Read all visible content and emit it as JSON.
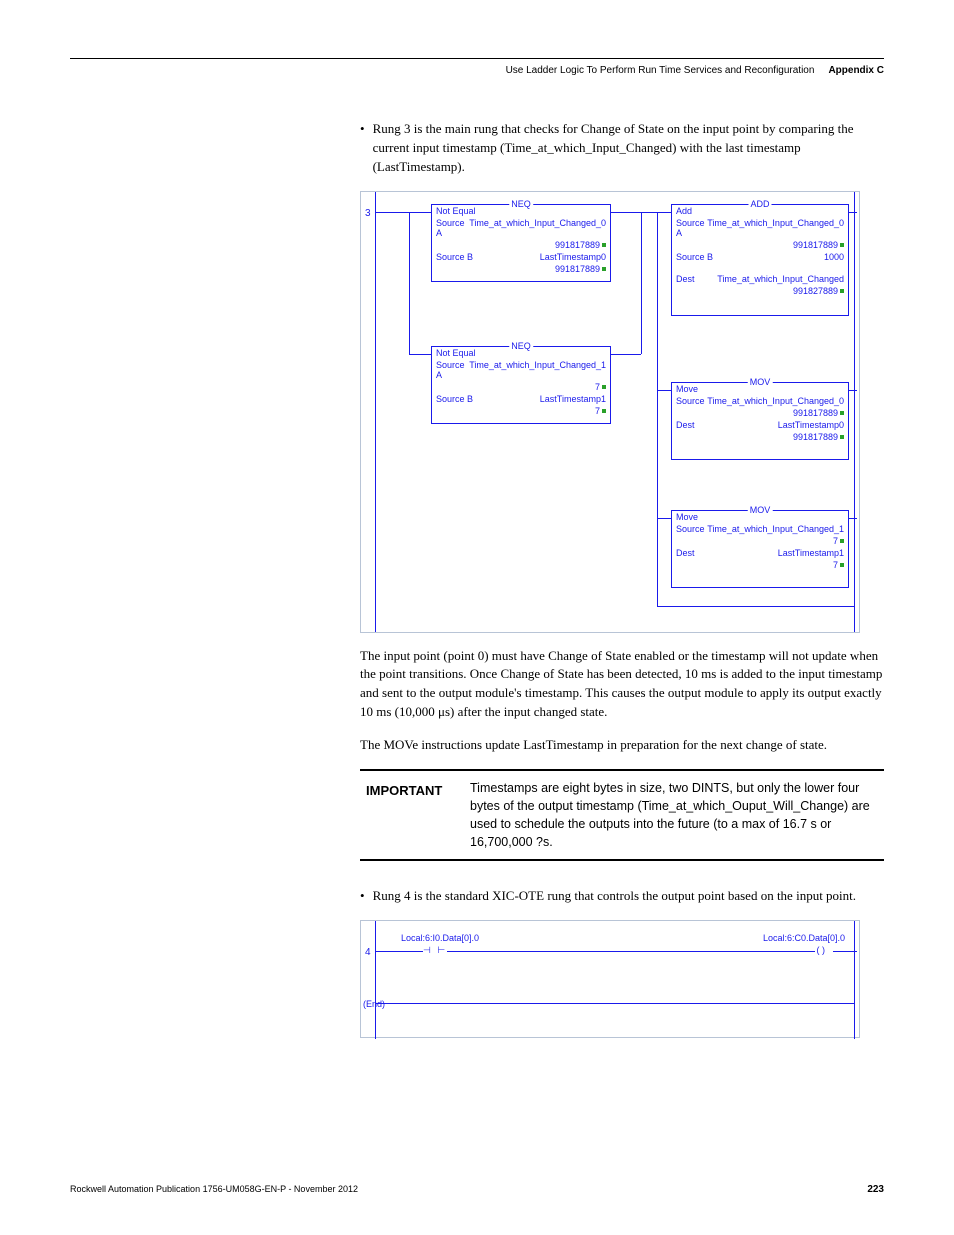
{
  "header": {
    "title": "Use Ladder Logic To Perform Run Time Services and Reconfiguration",
    "appendix": "Appendix C"
  },
  "bullet1": "Rung 3 is the main rung that checks for Change of State on the input point by comparing the current input timestamp (Time_at_which_Input_Changed) with the last timestamp (LastTimestamp).",
  "fig1": {
    "rung": "3",
    "neq1": {
      "title": "NEQ",
      "name": "Not Equal",
      "srcA_l": "Source A",
      "srcA_r": "Time_at_which_Input_Changed_0",
      "srcA_v": "991817889",
      "srcB_l": "Source B",
      "srcB_r": "LastTimestamp0",
      "srcB_v": "991817889"
    },
    "neq2": {
      "title": "NEQ",
      "name": "Not Equal",
      "srcA_l": "Source A",
      "srcA_r": "Time_at_which_Input_Changed_1",
      "srcA_v": "7",
      "srcB_l": "Source B",
      "srcB_r": "LastTimestamp1",
      "srcB_v": "7"
    },
    "add": {
      "title": "ADD",
      "name": "Add",
      "srcA_l": "Source A",
      "srcA_r": "Time_at_which_Input_Changed_0",
      "srcA_v": "991817889",
      "srcB_l": "Source B",
      "srcB_r": "1000",
      "srcB_v": "",
      "dest_l": "Dest",
      "dest_r": "Time_at_which_Input_Changed",
      "dest_v": "991827889"
    },
    "mov1": {
      "title": "MOV",
      "name": "Move",
      "src_l": "Source",
      "src_r": "Time_at_which_Input_Changed_0",
      "src_v": "991817889",
      "dest_l": "Dest",
      "dest_r": "LastTimestamp0",
      "dest_v": "991817889"
    },
    "mov2": {
      "title": "MOV",
      "name": "Move",
      "src_l": "Source",
      "src_r": "Time_at_which_Input_Changed_1",
      "src_v": "7",
      "dest_l": "Dest",
      "dest_r": "LastTimestamp1",
      "dest_v": "7"
    }
  },
  "para1": "The input point (point 0) must have Change of State enabled or the timestamp will not update when the point transitions. Once Change of State has been detected, 10 ms is added to the input timestamp and sent to the output module's timestamp. This causes the output module to apply its output exactly 10 ms (10,000 μs) after the input changed state.",
  "para2": "The MOVe instructions update LastTimestamp in preparation for the next change of state.",
  "callout": {
    "label": "IMPORTANT",
    "text": "Timestamps are eight bytes in size, two DINTS, but only the lower four bytes of the output timestamp (Time_at_which_Ouput_Will_Change) are used to schedule the outputs into the future (to a max of 16.7 s or 16,700,000 ?s."
  },
  "bullet2": "Rung 4 is the standard XIC-OTE rung that controls the output point based on the input point.",
  "fig2": {
    "rung": "4",
    "end": "(End)",
    "xic": "Local:6:I0.Data[0].0",
    "ote": "Local:6:C0.Data[0].0"
  },
  "footer": {
    "pub": "Rockwell Automation Publication 1756-UM058G-EN-P - November 2012",
    "page": "223"
  }
}
